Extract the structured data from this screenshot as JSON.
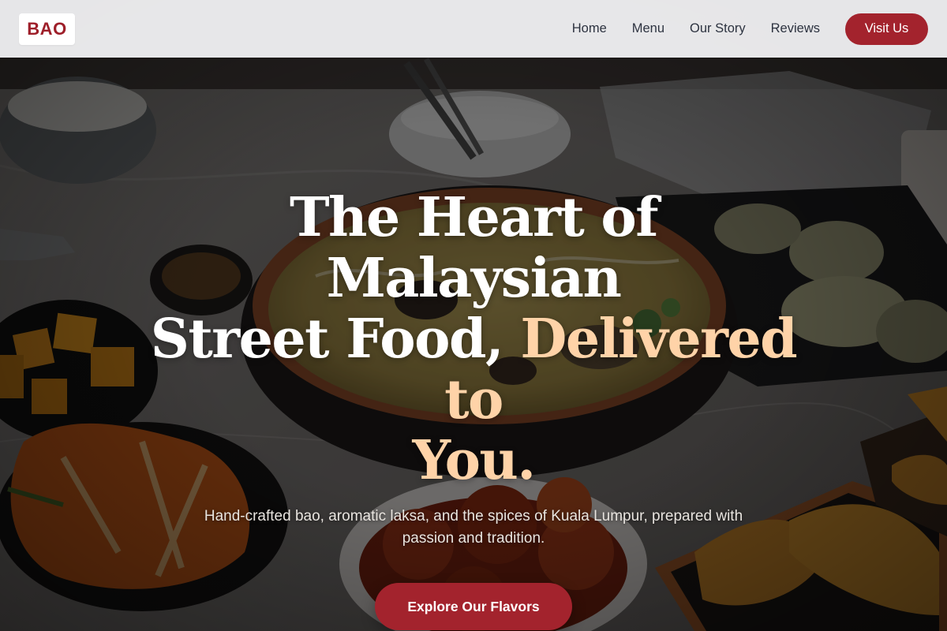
{
  "brand": {
    "logo_text": "BAO",
    "accent_color": "#a3232d"
  },
  "nav": {
    "items": [
      {
        "label": "Home"
      },
      {
        "label": "Menu"
      },
      {
        "label": "Our Story"
      },
      {
        "label": "Reviews"
      }
    ],
    "cta_label": "Visit Us"
  },
  "hero": {
    "headline_line1": "The Heart of Malaysian",
    "headline_line2_plain": "Street Food, ",
    "headline_line2_accent": "Delivered to",
    "headline_line3_accent": "You.",
    "accent_text_color": "#ffd3a8",
    "subtitle": "Hand-crafted bao, aromatic laksa, and the spices of Kuala Lumpur, prepared with passion and tradition.",
    "cta_label": "Explore Our Flavors",
    "background": "food-table-photo"
  }
}
